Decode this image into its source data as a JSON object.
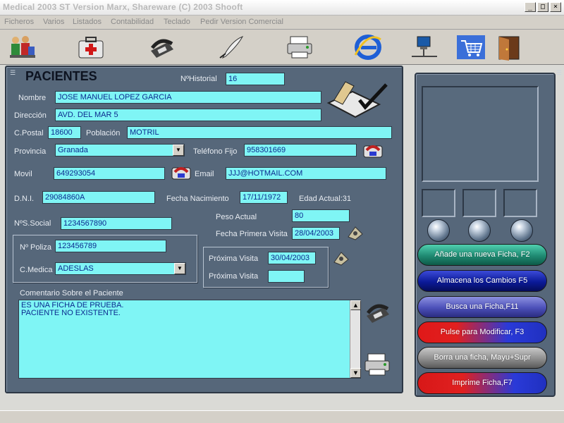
{
  "window": {
    "title": "Medical 2003 ST Version Marx, Shareware (C) 2003 Shooft"
  },
  "menu": [
    "Ficheros",
    "Varios",
    "Listados",
    "Contabilidad",
    "Teclado",
    "Pedir Version Comercial"
  ],
  "toolbar_icons": [
    "patients-icon",
    "medical-kit-icon",
    "phone-icon",
    "quill-pen-icon",
    "printer-icon",
    "internet-explorer-icon",
    "network-icon",
    "shopping-cart-icon",
    "exit-door-icon"
  ],
  "form": {
    "heading": "PACIENTES",
    "historial": {
      "label": "NºHistorial",
      "value": "16"
    },
    "nombre": {
      "label": "Nombre",
      "value": "JOSE MANUEL LOPEZ GARCIA"
    },
    "direccion": {
      "label": "Dirección",
      "value": "AVD. DEL MAR 5"
    },
    "cpostal": {
      "label": "C.Postal",
      "value": "18600"
    },
    "poblacion": {
      "label": "Población",
      "value": "MOTRIL"
    },
    "provincia": {
      "label": "Provincia",
      "value": "Granada"
    },
    "telefono_fijo": {
      "label": "Teléfono Fijo",
      "value": "958301669"
    },
    "movil": {
      "label": "Movil",
      "value": "649293054"
    },
    "email": {
      "label": "Email",
      "value": "JJJ@HOTMAIL.COM"
    },
    "dni": {
      "label": "D.N.I.",
      "value": "29084860A"
    },
    "fecha_nacimiento": {
      "label": "Fecha Nacimiento",
      "value": "17/11/1972"
    },
    "edad_actual": "Edad Actual:31",
    "peso_actual": {
      "label": "Peso Actual",
      "value": "80"
    },
    "ss": {
      "label": "NºS.Social",
      "value": "1234567890"
    },
    "fecha_primera_visita": {
      "label": "Fecha Primera Visita",
      "value": "28/04/2003"
    },
    "poliza": {
      "label": "Nº Poliza",
      "value": "123456789"
    },
    "cmedica": {
      "label": "C.Medica",
      "value": "ADESLAS"
    },
    "proxima_visita_1": {
      "label": "Próxima Visita",
      "value": "30/04/2003"
    },
    "proxima_visita_2": {
      "label": "Próxima Visita",
      "value": ""
    },
    "comentario": {
      "label": "Comentario Sobre el Paciente",
      "value": "ES UNA FICHA DE PRUEBA.\nPACIENTE NO EXISTENTE."
    }
  },
  "buttons": {
    "nueva": "Añade una nueva Ficha, F2",
    "almacena": "Almacena los Cambios F5",
    "busca": "Busca una Ficha,F11",
    "modificar": "Pulse para Modificar, F3",
    "borra": "Borra una ficha, Mayu+Supr",
    "imprime": "Imprime Ficha,F7"
  },
  "colors": {
    "panel": "#56677a",
    "field": "#7ff5f5",
    "field_text": "#0b2a8f",
    "btn_nueva": "#1f8a72",
    "btn_almacena": "#0b1a98",
    "btn_busca": "#4b4fb8",
    "btn_modificar": "#c81a20",
    "btn_borra": "#8e8e8e",
    "btn_imprime": "#c01818"
  }
}
